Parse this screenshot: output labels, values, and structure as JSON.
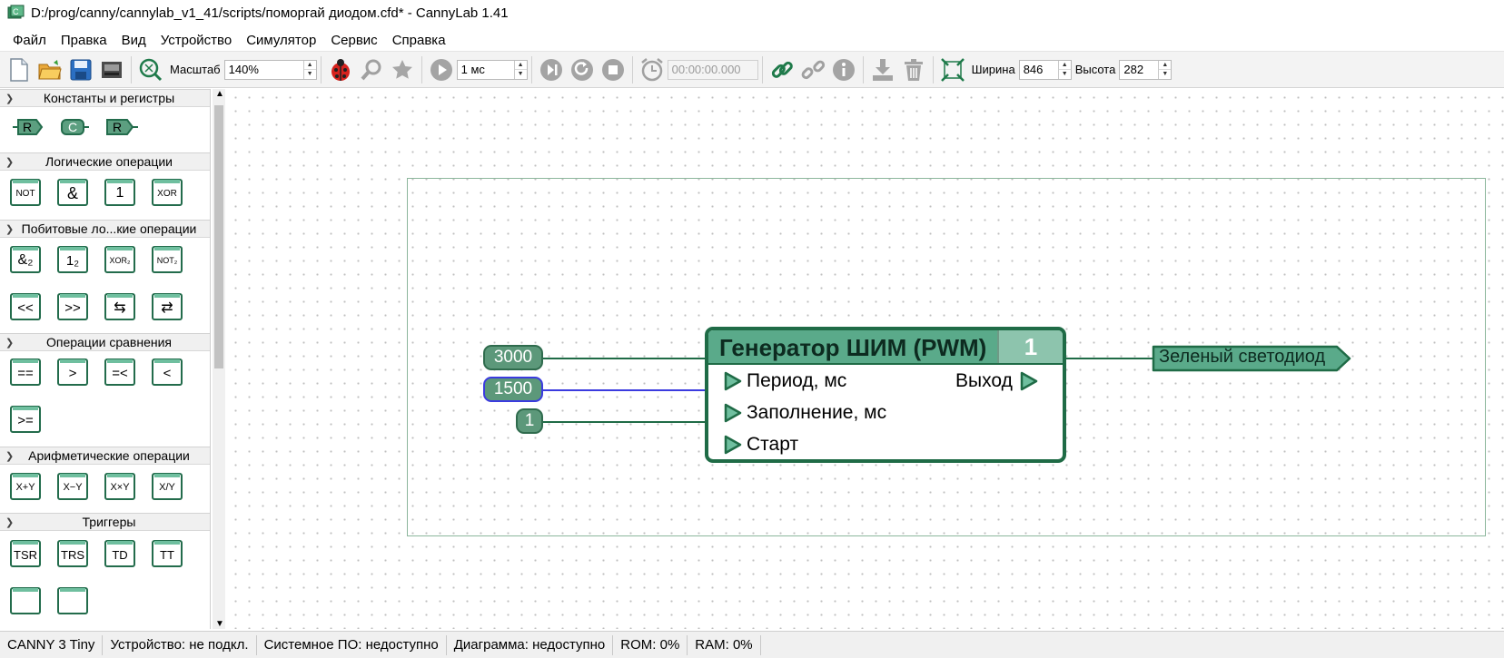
{
  "window": {
    "title": "D:/prog/canny/cannylab_v1_41/scripts/поморгай диодом.cfd* - CannyLab 1.41"
  },
  "menu": [
    "Файл",
    "Правка",
    "Вид",
    "Устройство",
    "Симулятор",
    "Сервис",
    "Справка"
  ],
  "toolbar": {
    "zoom_label": "Масштаб",
    "zoom_value": "140%",
    "step_value": "1 мс",
    "time_value": "00:00:00.000",
    "width_label": "Ширина",
    "width_value": "846",
    "height_label": "Высота",
    "height_value": "282"
  },
  "sidebar": {
    "sections": [
      {
        "title": "Константы и регистры",
        "blocks": [
          "R",
          "C",
          "R"
        ]
      },
      {
        "title": "Логические операции",
        "blocks": [
          "NOT",
          "&",
          "1",
          "XOR"
        ]
      },
      {
        "title": "Побитовые ло...кие операции",
        "blocks": [
          "&₂",
          "1₂",
          "XOR₂",
          "NOT₂",
          "<<",
          ">>",
          "⇆",
          "⇄"
        ]
      },
      {
        "title": "Операции сравнения",
        "blocks": [
          "==",
          ">",
          "=<",
          "<",
          ">="
        ]
      },
      {
        "title": "Арифметические операции",
        "blocks": [
          "X+Y",
          "X−Y",
          "X×Y",
          "X/Y"
        ]
      },
      {
        "title": "Триггеры",
        "blocks": [
          "TSR",
          "TRS",
          "TD",
          "TT"
        ]
      }
    ]
  },
  "diagram": {
    "block": {
      "title": "Генератор ШИМ (PWM)",
      "number": "1",
      "inputs": [
        "Период, мс",
        "Заполнение, мс",
        "Старт"
      ],
      "output": "Выход"
    },
    "constants": [
      "3000",
      "1500",
      "1"
    ],
    "output_tag": "Зеленый светодиод"
  },
  "status": [
    "CANNY 3 Tiny",
    "Устройство: не подкл.",
    "Системное ПО: недоступно",
    "Диаграмма: недоступно",
    "ROM: 0%",
    "RAM: 0%"
  ]
}
